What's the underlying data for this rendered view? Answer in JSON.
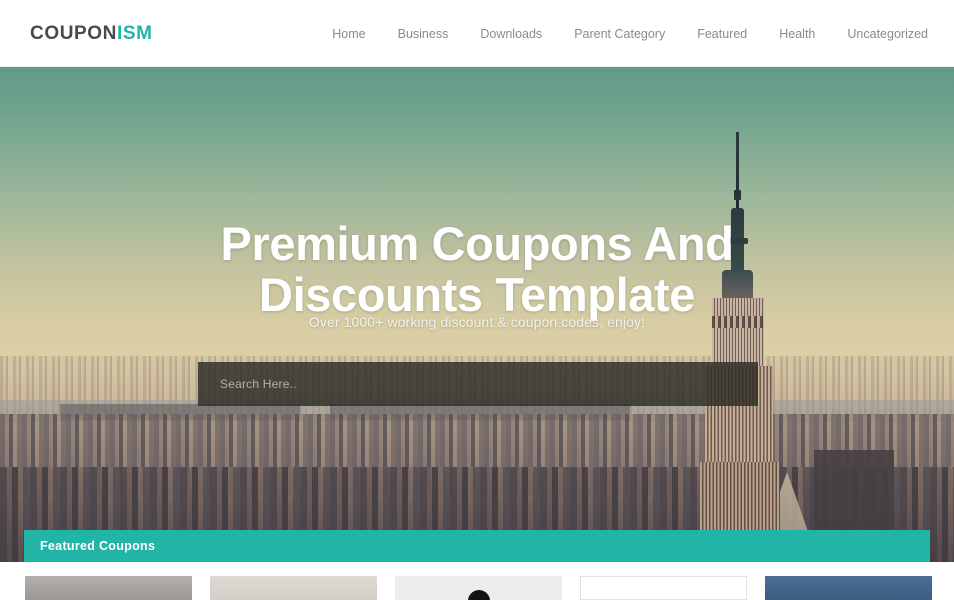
{
  "header": {
    "logo": {
      "primary": "COUPON",
      "accent": "ISM"
    },
    "nav": [
      {
        "label": "Home"
      },
      {
        "label": "Business"
      },
      {
        "label": "Downloads"
      },
      {
        "label": "Parent Category"
      },
      {
        "label": "Featured"
      },
      {
        "label": "Health"
      },
      {
        "label": "Uncategorized"
      }
    ]
  },
  "hero": {
    "title": "Premium Coupons And Discounts Template",
    "subtitle": "Over 1000+ working discount & coupon codes, enjoy!",
    "search": {
      "value": "",
      "placeholder": "Search Here.."
    }
  },
  "featured": {
    "title": "Featured Coupons"
  },
  "cards": [
    {
      "name": "coupon-card-1",
      "style": "thumb-gray"
    },
    {
      "name": "coupon-card-2",
      "style": "thumb-beige"
    },
    {
      "name": "coupon-card-3",
      "style": "thumb-light"
    },
    {
      "name": "coupon-card-4",
      "style": "thumb-white"
    },
    {
      "name": "coupon-card-5",
      "style": "thumb-blue"
    }
  ],
  "colors": {
    "accent_teal": "#22b4a6",
    "logo_dark": "#4a4a4a",
    "nav_text": "#8a8a8a",
    "search_overlay": "#2c2b26",
    "hero_title": "#ffffff"
  }
}
